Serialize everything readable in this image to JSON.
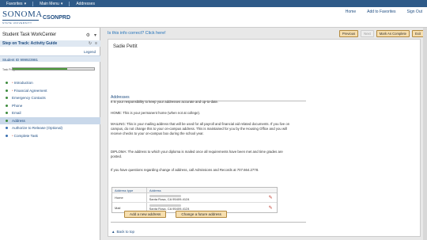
{
  "topbar": {
    "favorites": "Favorites",
    "main_menu": "Main Menu",
    "addresses": "Addresses"
  },
  "brand": {
    "logo_name": "SONOMA",
    "logo_sub": "STATE UNIVERSITY",
    "system": "CSONPRD"
  },
  "header_links": [
    "Home",
    "Add to Favorites",
    "Sign Out"
  ],
  "left_panel": {
    "title": "Student Task WorkCenter",
    "guide_title": "Step on Track: Activity Guide",
    "legend": "Legend",
    "student_id": "Student ID 999923981",
    "progress_label": "Task Progress",
    "progress_value": 0.67,
    "tasks": [
      {
        "label": "Introduction",
        "required": true,
        "dot": "green",
        "active": false
      },
      {
        "label": "Financial Agreement",
        "required": true,
        "dot": "green",
        "active": false
      },
      {
        "label": "Emergency Contacts",
        "required": false,
        "dot": "green",
        "active": false
      },
      {
        "label": "Phone",
        "required": false,
        "dot": "green",
        "active": false
      },
      {
        "label": "Email",
        "required": false,
        "dot": "green",
        "active": false
      },
      {
        "label": "Address",
        "required": false,
        "dot": "green",
        "active": true
      },
      {
        "label": "Authorize to Release (Optional)",
        "required": false,
        "dot": "blue",
        "active": false
      },
      {
        "label": "Complete Task",
        "required": true,
        "dot": "blue",
        "active": false
      }
    ]
  },
  "main": {
    "correct_link": "Is this info correct? Click here!",
    "nav": {
      "previous": "Previous",
      "next": "Next",
      "mark_complete": "Mark As Complete",
      "exit": "Exit"
    },
    "student_name": "Sadie Pettit",
    "section_title": "Addresses",
    "paragraphs": [
      "It is your responsibility to keep your addresses accurate and up-to-date.",
      "HOME: This is your permanent home (when not at college).",
      "MAILING: This is your mailing address that will be used for all payroll and financial aid related documents. If you live on campus, do not change this to your on-campus address. This is maintained for you by the Housing Office and you will receive checks to your on-campus box during the school year.",
      "DIPLOMA: The address to which your diploma is mailed once all requirements have been met and time grades are posted.",
      "If you have questions regarding change of address, call Admissions and Records at 707.664.2778."
    ],
    "table": {
      "headers": [
        "Address type",
        "Address"
      ],
      "rows": [
        {
          "type": "Home",
          "address_line2": "Santa Rosa, CA 95409-4124"
        },
        {
          "type": "Mail",
          "address_line2": "Santa Rosa, CA 95409-4124"
        }
      ]
    },
    "add_button": "Add a new address",
    "change_button": "Change a future address",
    "back_to_top": "Back to top"
  },
  "colors": {
    "topbar": "#2e5a88",
    "brand_blue": "#1e4c80",
    "progress": "#4e9a3c",
    "active_task": "#c9d8ea"
  }
}
